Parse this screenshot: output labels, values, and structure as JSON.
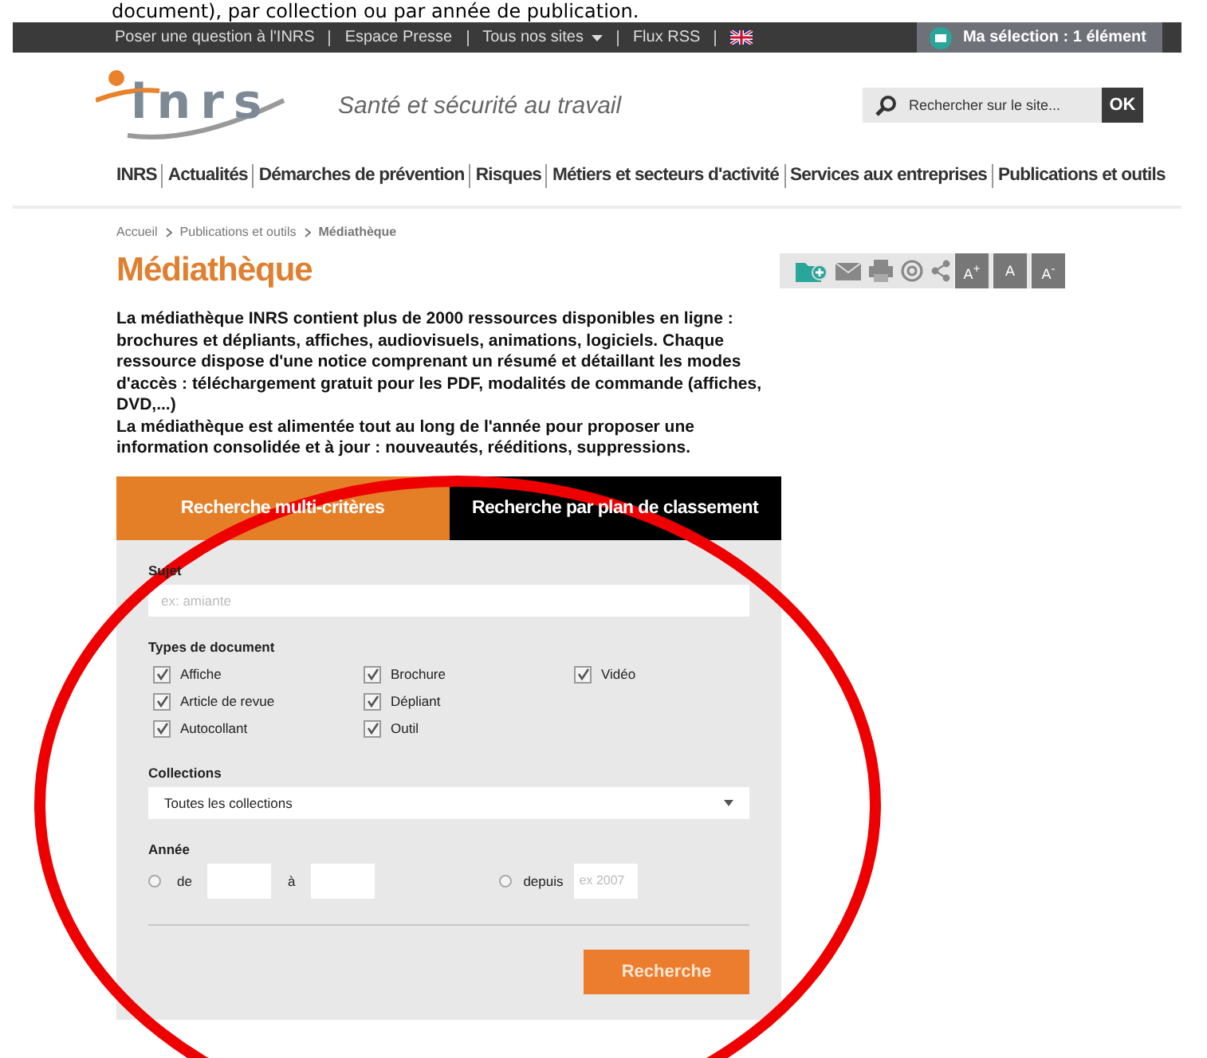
{
  "caption": "document), par collection ou par année de publication.",
  "top_bar": {
    "links": [
      {
        "label": "Poser une question à l'INRS",
        "kind": "link"
      },
      {
        "label": "Espace Presse",
        "kind": "link"
      },
      {
        "label": "Tous nos sites",
        "kind": "dropdown"
      },
      {
        "label": "Flux RSS",
        "kind": "link"
      },
      {
        "kind": "flag"
      }
    ],
    "selection": "Ma sélection : 1 élément"
  },
  "header": {
    "logo": "inrs",
    "tagline": "Santé et sécurité au travail",
    "search": {
      "placeholder": "Rechercher sur le site...",
      "button": "OK"
    }
  },
  "nav": [
    "INRS",
    "Actualités",
    "Démarches de prévention",
    "Risques",
    "Métiers et secteurs d'activité",
    "Services aux entreprises",
    "Publications et outils"
  ],
  "breadcrumb": [
    "Accueil",
    "Publications et outils",
    "Médiathèque"
  ],
  "title": "Médiathèque",
  "font_sizes": [
    "A$^{+}$",
    "A",
    "A$^{-}$"
  ],
  "intro": [
    "La médiathèque INRS contient plus de 2000 ressources disponibles en ligne : brochures et dépliants, affiches, audiovisuels, animations, logiciels. Chaque ressource dispose d'une notice comprenant un résumé et détaillant les modes d'accès : téléchargement gratuit pour les PDF, modalités de commande (affiches, DVD,...)",
    "La médiathèque est alimentée tout au long de l'année pour proposer une information consolidée et à jour : nouveautés, rééditions, suppressions."
  ],
  "tabs": [
    {
      "label": "Recherche multi-critères",
      "selected": true
    },
    {
      "label": "Recherche par plan de classement",
      "selected": false
    }
  ],
  "form": {
    "subject": {
      "label": "Sujet",
      "placeholder": "ex: amiante"
    },
    "doc_types": {
      "label": "Types de document",
      "options": [
        {
          "label": "Affiche",
          "checked": true
        },
        {
          "label": "Article de revue",
          "checked": true
        },
        {
          "label": "Autocollant",
          "checked": true
        },
        {
          "label": "Brochure",
          "checked": true
        },
        {
          "label": "Dépliant",
          "checked": true
        },
        {
          "label": "Outil",
          "checked": true
        },
        {
          "label": "Vidéo",
          "checked": true
        }
      ]
    },
    "collections": {
      "label": "Collections",
      "value": "Toutes les collections"
    },
    "year": {
      "label": "Année",
      "options": [
        {
          "kind": "range",
          "selected": false,
          "from_label": "de",
          "to_label": "à"
        },
        {
          "kind": "since",
          "selected": false,
          "label": "depuis",
          "placeholder": "ex 2007"
        }
      ]
    },
    "submit": "Recherche"
  },
  "annotation": {
    "kind": "ellipse",
    "color": "#ee0000"
  }
}
